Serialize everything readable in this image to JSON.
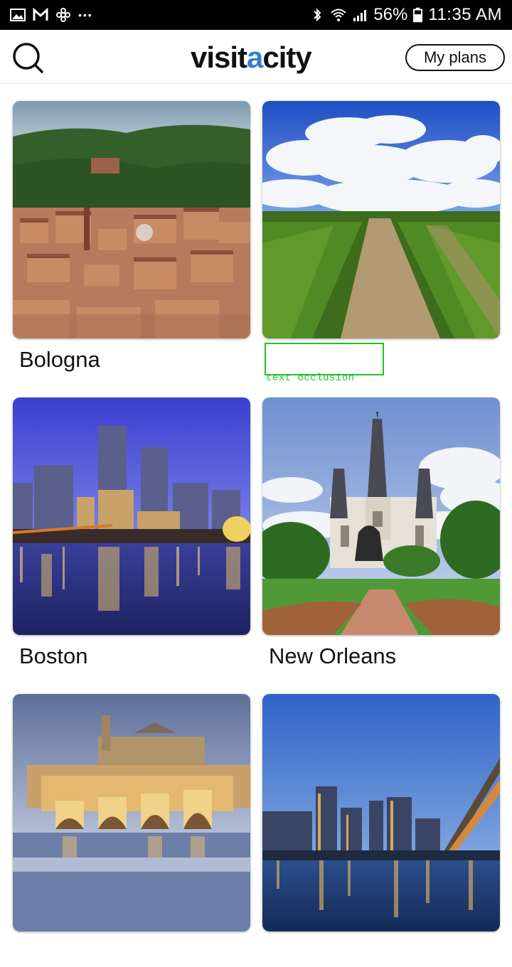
{
  "status_bar": {
    "battery": "56%",
    "time": "11:35 AM",
    "more": "•••"
  },
  "header": {
    "logo_part1": "visit",
    "logo_accent": "a",
    "logo_part2": "city",
    "my_plans_label": "My plans"
  },
  "cities": [
    {
      "name": "Bologna"
    },
    {
      "name": ""
    },
    {
      "name": "Boston"
    },
    {
      "name": "New Orleans"
    },
    {
      "name": ""
    },
    {
      "name": ""
    }
  ],
  "annotation": {
    "label": "text occlusion"
  },
  "colors": {
    "accent": "#2f7fd0",
    "occlusion": "#22c32a"
  }
}
